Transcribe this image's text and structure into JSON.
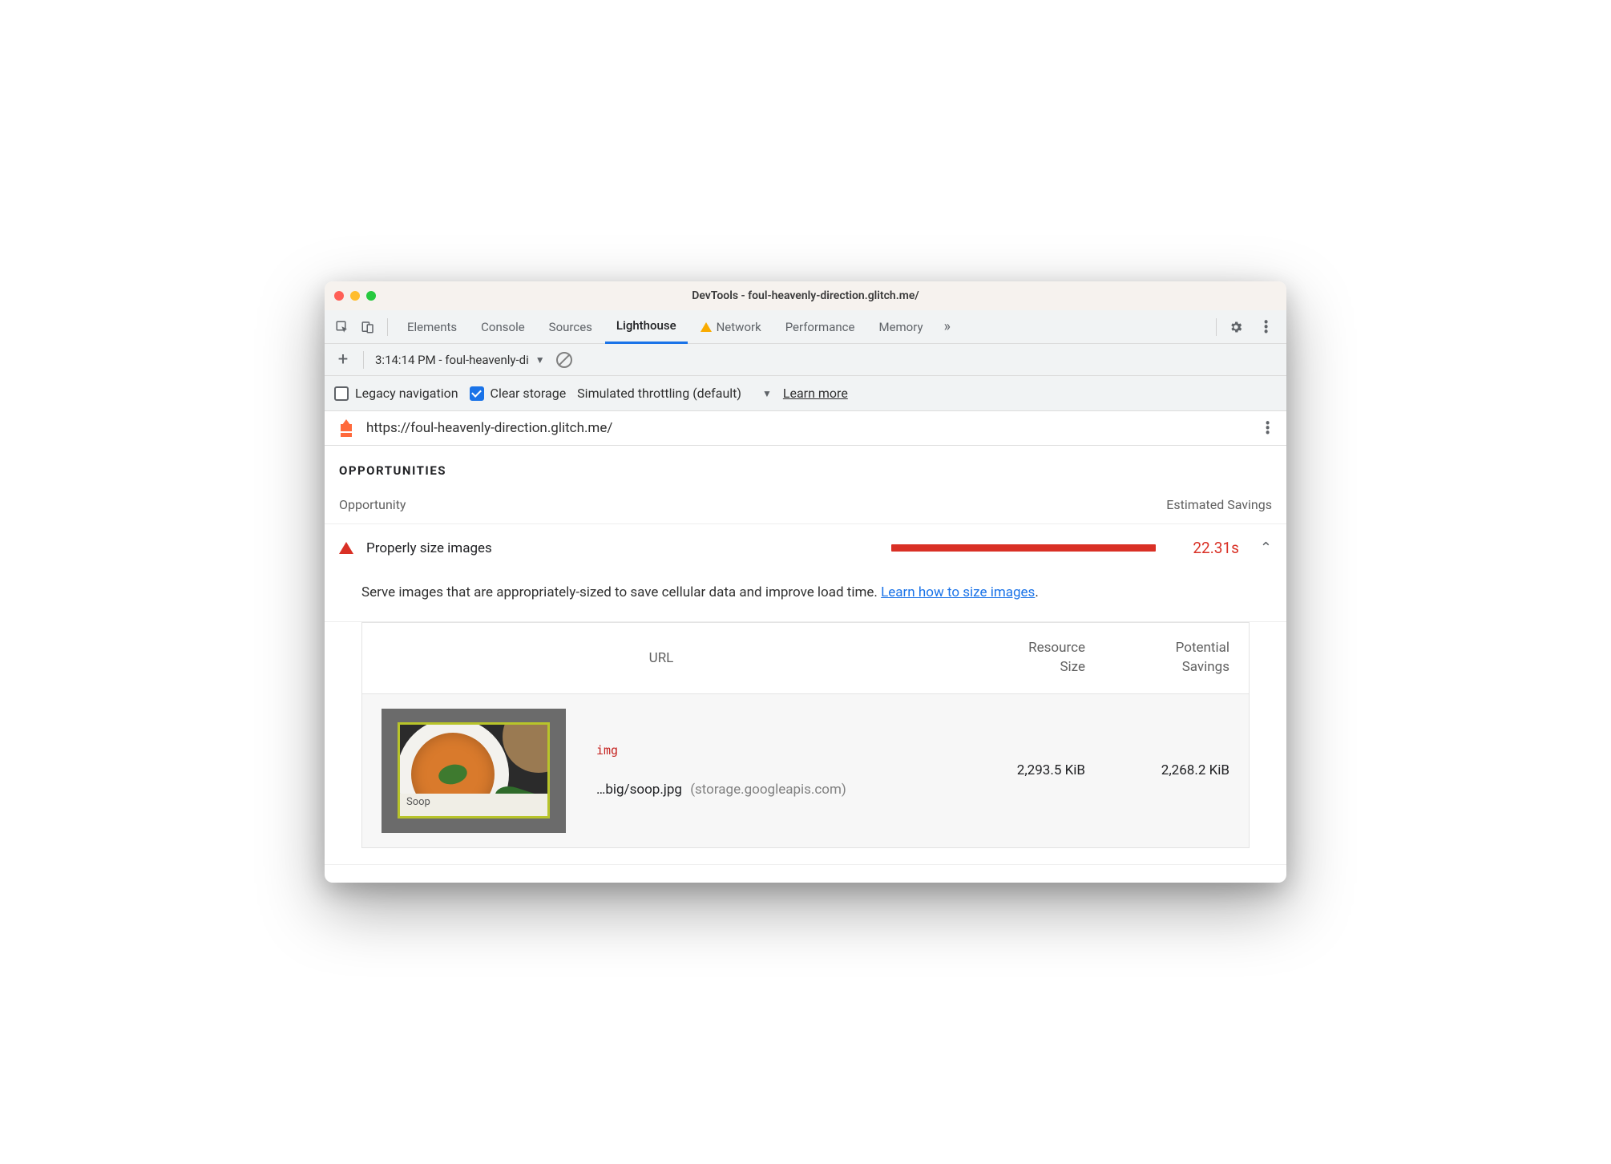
{
  "window": {
    "title": "DevTools - foul-heavenly-direction.glitch.me/"
  },
  "tabs": {
    "elements": "Elements",
    "console": "Console",
    "sources": "Sources",
    "lighthouse": "Lighthouse",
    "network": "Network",
    "performance": "Performance",
    "memory": "Memory"
  },
  "toolbar1": {
    "run_label": "3:14:14 PM - foul-heavenly-di"
  },
  "toolbar2": {
    "legacy_label": "Legacy navigation",
    "clear_label": "Clear storage",
    "throttle_label": "Simulated throttling (default)",
    "learn_more": "Learn more"
  },
  "urlbar": {
    "url": "https://foul-heavenly-direction.glitch.me/"
  },
  "section": {
    "title": "OPPORTUNITIES"
  },
  "headers": {
    "opportunity": "Opportunity",
    "savings": "Estimated Savings"
  },
  "opportunity": {
    "title": "Properly size images",
    "time": "22.31s",
    "description_prefix": "Serve images that are appropriately-sized to save cellular data and improve load time. ",
    "link_text": "Learn how to size images",
    "description_suffix": "."
  },
  "detail": {
    "col_url": "URL",
    "col_size_a": "Resource",
    "col_size_b": "Size",
    "col_sav_a": "Potential",
    "col_sav_b": "Savings",
    "row": {
      "tag": "img",
      "path": "…big/soop.jpg",
      "host": "(storage.googleapis.com)",
      "size": "2,293.5 KiB",
      "savings": "2,268.2 KiB",
      "thumb_caption": "Soop"
    }
  }
}
